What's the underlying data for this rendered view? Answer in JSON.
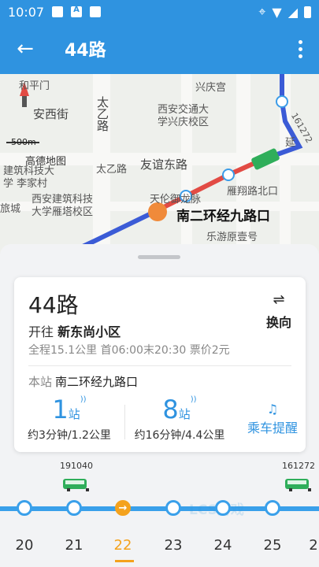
{
  "status_bar": {
    "time": "10:07"
  },
  "header": {
    "title": "44路"
  },
  "map": {
    "labels": [
      "和平门",
      "安西街",
      "太乙路",
      "西安交通大学兴庆校区",
      "兴庆宫",
      "友谊东路",
      "太乙路",
      "雁翔路北口",
      "天伦御龙脉",
      "西安建筑科技大学雁塔校区",
      "旅城",
      "乐游原壹号",
      "延",
      "高德地图",
      "500m",
      "建筑科技大学 李家村",
      "南二环经九路口",
      "161272"
    ],
    "current_stop_label": "南二环经九路口",
    "scale": "500m",
    "provider": "高德地图"
  },
  "card": {
    "route_name": "44路",
    "direction_prefix": "开往",
    "direction_dest": "新东尚小区",
    "info": "全程15.1公里  首06:00末20:30  票价2元",
    "switch_label": "换向",
    "station_prefix": "本站",
    "station_name": "南二环经九路口",
    "buses": [
      {
        "num": "1",
        "unit": "站",
        "eta": "约3分钟/1.2公里"
      },
      {
        "num": "8",
        "unit": "站",
        "eta": "约16分钟/4.4公里"
      }
    ],
    "remind_label": "乘车提醒"
  },
  "timeline": {
    "bus_ids": [
      "191040",
      "161272"
    ],
    "stops": [
      "20",
      "21",
      "22",
      "23",
      "24",
      "25",
      "2"
    ],
    "current_index": 2,
    "watermark": "LCS游戏"
  },
  "colors": {
    "primary": "#2f93e0",
    "current": "#f4a21d",
    "bus": "#2fae5a"
  }
}
